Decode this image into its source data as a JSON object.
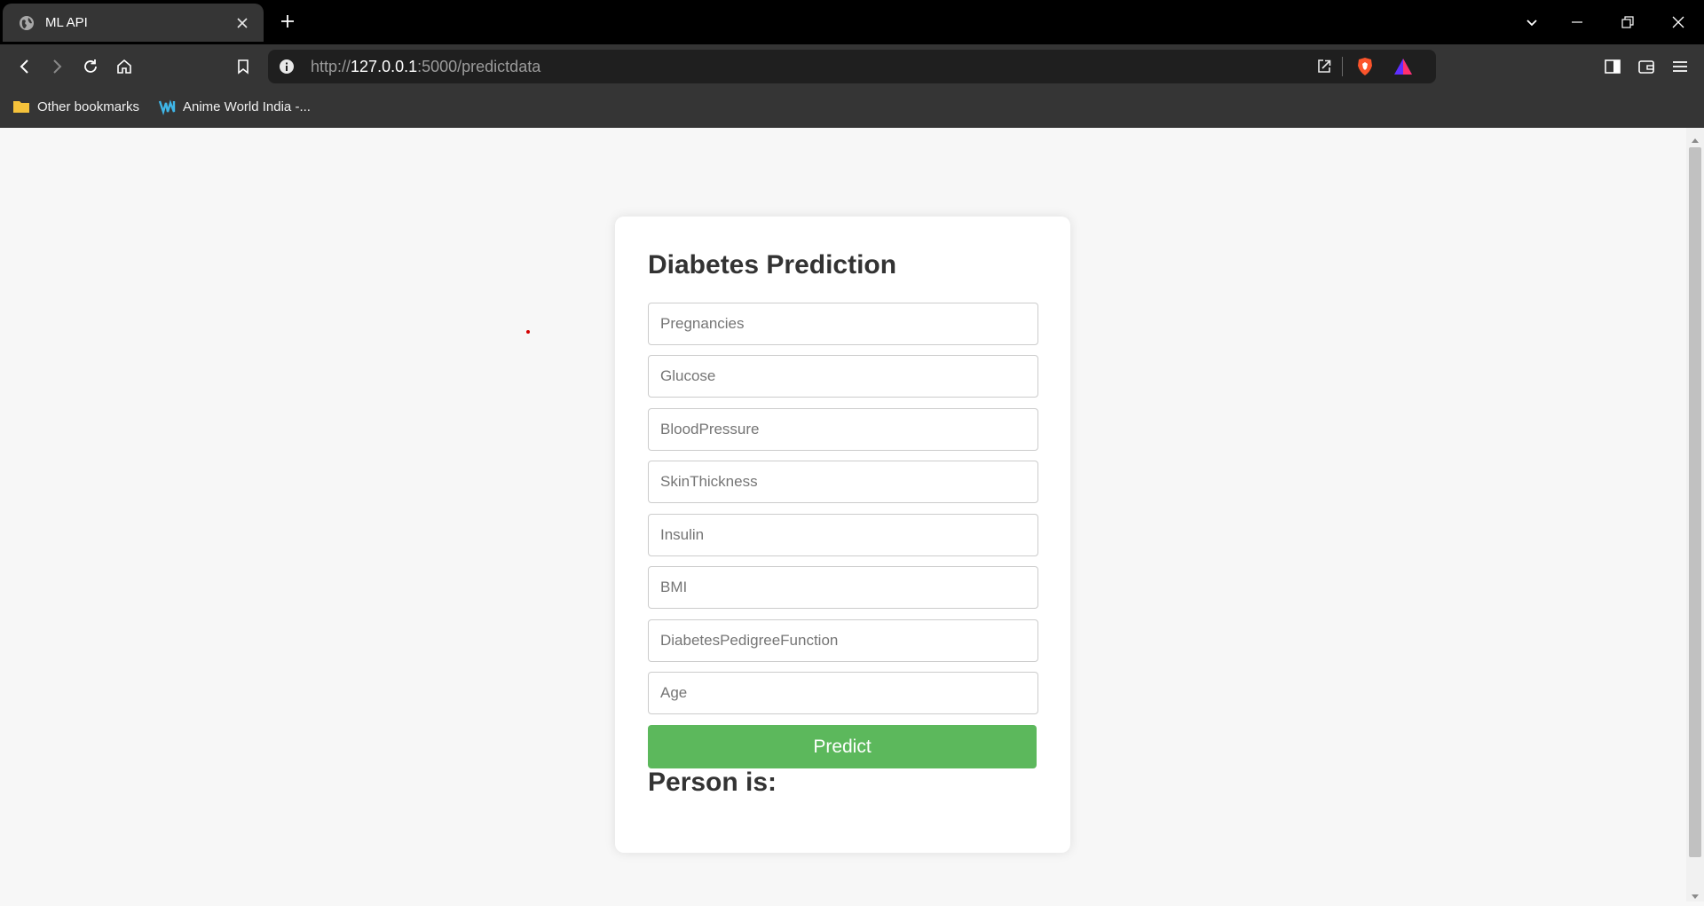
{
  "browser": {
    "tab": {
      "title": "ML API",
      "icon": "globe-icon"
    },
    "address_bar": {
      "scheme": "http://",
      "host": "127.0.0.1",
      "rest": ":5000/predictdata"
    },
    "bookmarks": [
      {
        "label": "Other bookmarks",
        "icon": "folder-icon"
      },
      {
        "label": "Anime World India -...",
        "icon": "site-favicon"
      }
    ],
    "colors": {
      "titlebar": "#000000",
      "toolbar": "#353535",
      "omnibox": "#1f1f1f"
    }
  },
  "form": {
    "title": "Diabetes Prediction",
    "fields": [
      {
        "placeholder": "Pregnancies",
        "value": ""
      },
      {
        "placeholder": "Glucose",
        "value": ""
      },
      {
        "placeholder": "BloodPressure",
        "value": ""
      },
      {
        "placeholder": "SkinThickness",
        "value": ""
      },
      {
        "placeholder": "Insulin",
        "value": ""
      },
      {
        "placeholder": "BMI",
        "value": ""
      },
      {
        "placeholder": "DiabetesPedigreeFunction",
        "value": ""
      },
      {
        "placeholder": "Age",
        "value": ""
      }
    ],
    "submit_label": "Predict",
    "result_label": "Person is:",
    "colors": {
      "button": "#5cb85c",
      "text": "#333333",
      "background": "#f7f7f7"
    }
  }
}
